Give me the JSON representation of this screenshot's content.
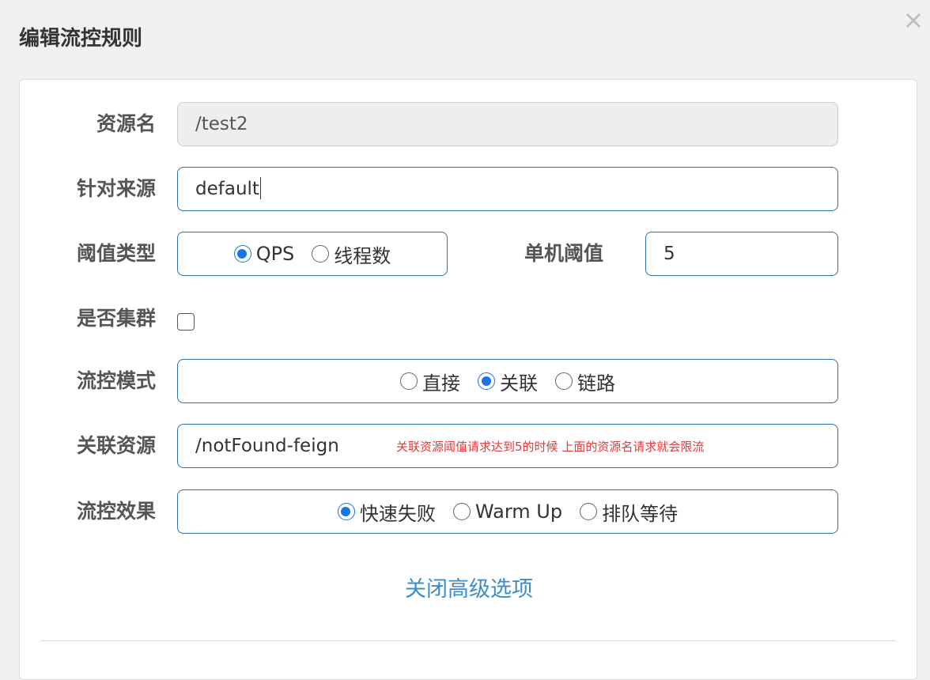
{
  "dialog": {
    "title": "编辑流控规则",
    "close_icon": "×"
  },
  "form": {
    "resource_name": {
      "label": "资源名",
      "value": "/test2"
    },
    "limit_app": {
      "label": "针对来源",
      "value": "default"
    },
    "threshold_type": {
      "label": "阈值类型",
      "options": [
        "QPS",
        "线程数"
      ],
      "selected": "QPS"
    },
    "single_threshold": {
      "label": "单机阈值",
      "value": "5"
    },
    "cluster": {
      "label": "是否集群",
      "checked": false
    },
    "strategy": {
      "label": "流控模式",
      "options": [
        "直接",
        "关联",
        "链路"
      ],
      "selected": "关联"
    },
    "ref_resource": {
      "label": "关联资源",
      "value": "/notFound-feign",
      "annotation": "关联资源阈值请求达到5的时候  上面的资源名请求就会限流"
    },
    "control_behavior": {
      "label": "流控效果",
      "options": [
        "快速失败",
        "Warm Up",
        "排队等待"
      ],
      "selected": "快速失败"
    },
    "advanced_toggle": "关闭高级选项"
  },
  "colors": {
    "accent": "#1a73e8",
    "border": "#2f6fa8",
    "link": "#3c8dcc",
    "annotation": "#e03a3a"
  }
}
